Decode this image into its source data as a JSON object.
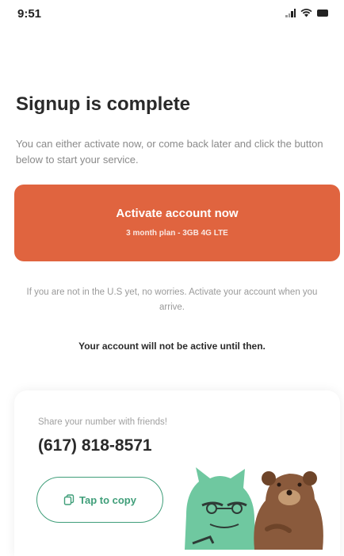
{
  "status_bar": {
    "time": "9:51",
    "icons": [
      "signal-icon",
      "wifi-icon",
      "battery-icon"
    ]
  },
  "main": {
    "title": "Signup is complete",
    "subtitle": "You can either activate now, or come back later and click the button below to start your service.",
    "activate": {
      "label": "Activate account now",
      "plan": "3 month plan - 3GB 4G LTE"
    },
    "notice": "If you are not in the U.S yet, no worries. Activate your account when you arrive.",
    "warning": "Your account will not be active until then."
  },
  "share": {
    "label": "Share your number with friends!",
    "phone": "(617) 818-8571",
    "copy_label": "Tap to copy"
  },
  "colors": {
    "accent": "#e0643f",
    "green": "#3f9e79",
    "text": "#2a2a2a",
    "muted": "#8a8a8a"
  }
}
